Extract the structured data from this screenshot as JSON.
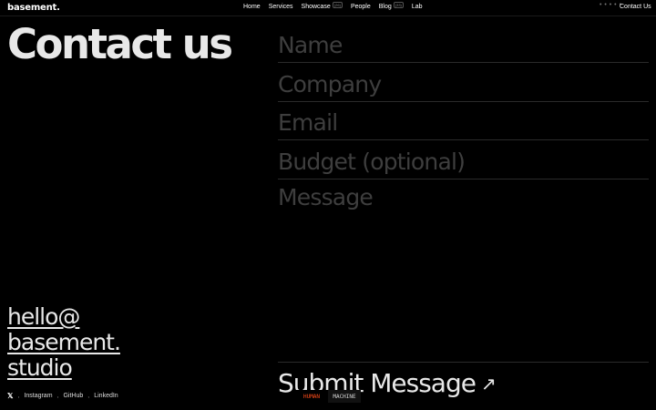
{
  "header": {
    "logo": "basement.",
    "nav": [
      {
        "label": "Home",
        "badge": ""
      },
      {
        "label": "Services",
        "badge": ""
      },
      {
        "label": "Showcase",
        "badge": "(26)"
      },
      {
        "label": "People",
        "badge": ""
      },
      {
        "label": "Blog",
        "badge": "(33)"
      },
      {
        "label": "Lab",
        "badge": ""
      }
    ],
    "dots": "• • • • •",
    "contact": "Contact Us"
  },
  "page": {
    "title": "Contact us",
    "email_lines": [
      "hello@",
      "basement.",
      "studio"
    ]
  },
  "socials": {
    "x_icon": "𝕏",
    "items": [
      "Instagram",
      "GitHub",
      "LinkedIn"
    ]
  },
  "form": {
    "name_placeholder": "Name",
    "company_placeholder": "Company",
    "email_placeholder": "Email",
    "budget_placeholder": "Budget (optional)",
    "message_placeholder": "Message",
    "submit_label": "Submit Message",
    "submit_arrow": "↗"
  },
  "toggle": {
    "human": "HUMAN",
    "machine": "MACHINE"
  },
  "colors": {
    "background": "#000000",
    "accent": "#ff4d1a",
    "placeholder": "#3e3e3e"
  }
}
